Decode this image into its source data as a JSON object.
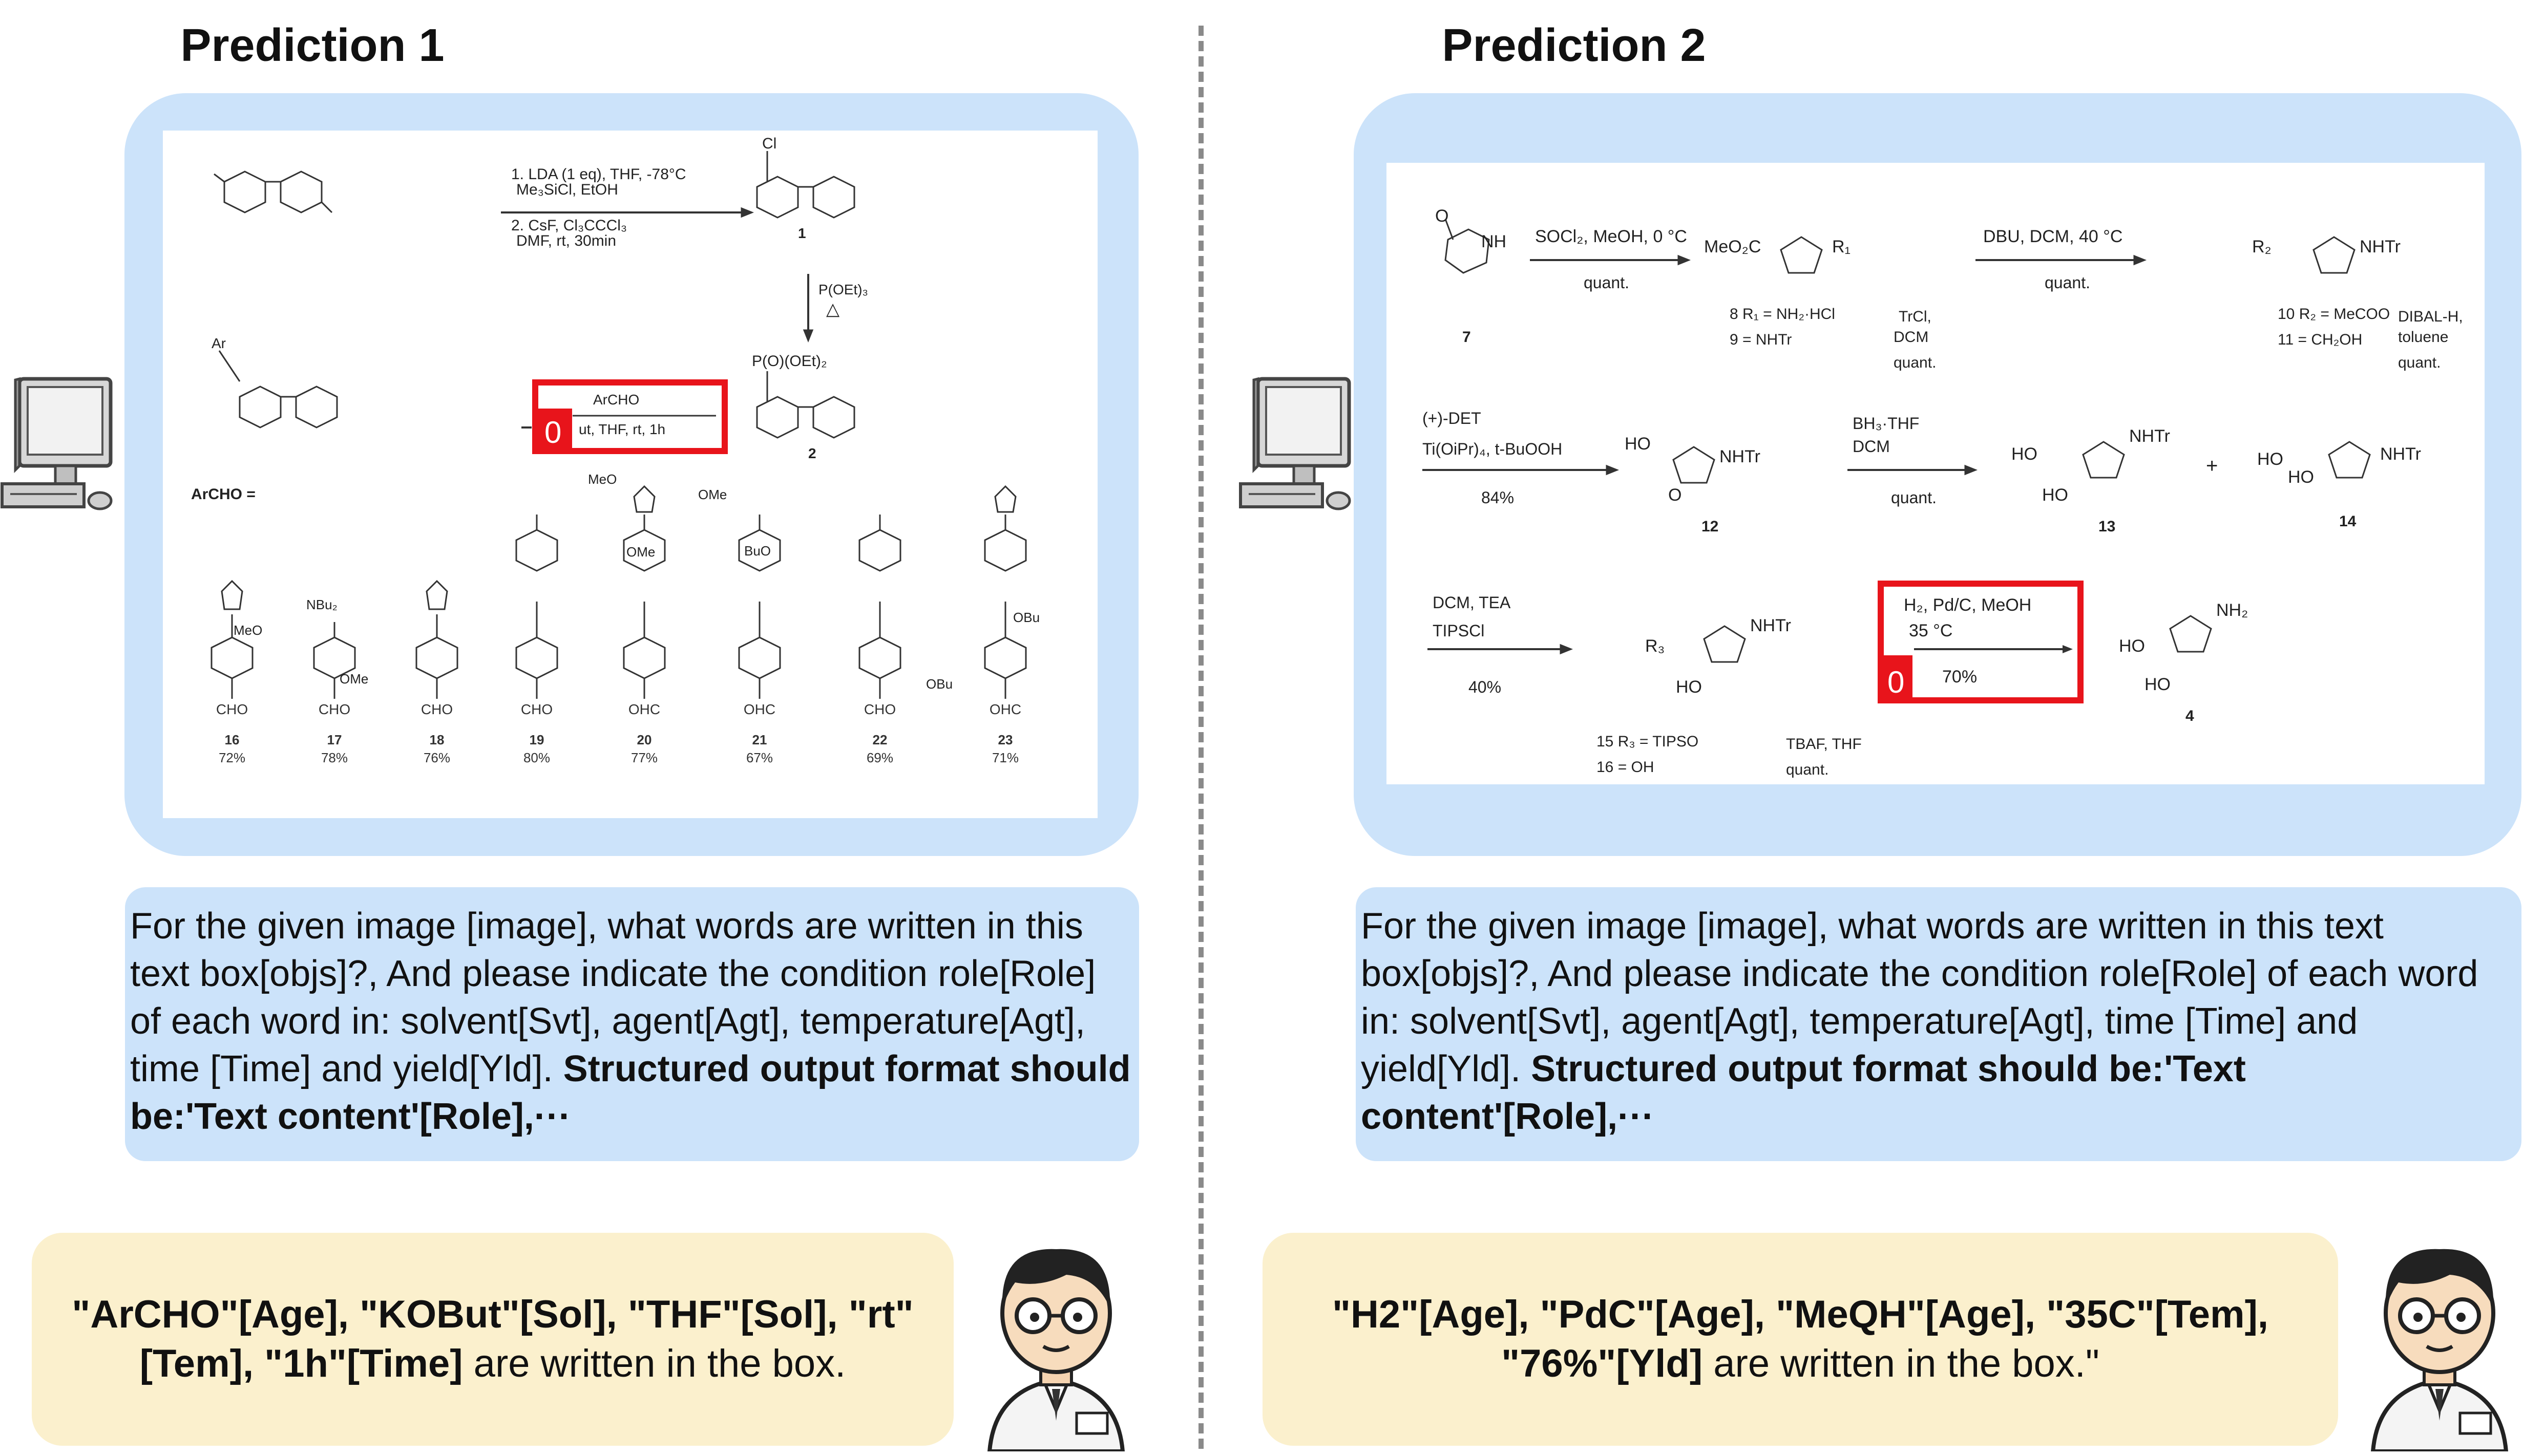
{
  "left": {
    "title": "Prediction 1",
    "question_plain": "For the given image [image], what words are written in this text box[objs]?, And please indicate the condition role[Role] of each word in: solvent[Svt], agent[Agt], temperature[Agt], time [Time] and yield[Yld].",
    "question_bold": "Structured output format should be:'Text content'[Role],···",
    "answer_bold": "\"ArCHO\"[Age], \"KOBut\"[Sol], \"THF\"[Sol], \"rt\" [Tem],  \"1h\"[Time]",
    "answer_plain": " are written in the box.",
    "scheme": {
      "cond_top_1": "1. LDA (1 eq), THF, -78°C",
      "cond_top_2": "Me₃SiCl, EtOH",
      "cond_top_3": "2. CsF, Cl₃CCCl₃",
      "cond_top_4": "DMF, rt, 30min",
      "cond_down": "P(OEt)₃",
      "cond_down_sym": "△",
      "label_1": "1",
      "label_2": "2",
      "phosphonate": "P(O)(OEt)₂",
      "cl": "Cl",
      "ar": "Ar",
      "box_line1": "ArCHO",
      "box_line2": "ut, THF, rt, 1h",
      "box_index": "0",
      "archo_eq": "ArCHO =",
      "compounds": [
        {
          "id": "16",
          "yld": "72%",
          "grp": "CHO"
        },
        {
          "id": "17",
          "yld": "78%",
          "grp": "CHO"
        },
        {
          "id": "18",
          "yld": "76%",
          "grp": "CHO"
        },
        {
          "id": "19",
          "yld": "80%",
          "grp": "CHO"
        },
        {
          "id": "20",
          "yld": "77%",
          "grp": "OHC"
        },
        {
          "id": "21",
          "yld": "67%",
          "grp": "OHC"
        },
        {
          "id": "22",
          "yld": "69%",
          "grp": "CHO"
        },
        {
          "id": "23",
          "yld": "71%",
          "grp": "OHC"
        }
      ],
      "subst": {
        "meo": "MeO",
        "ome": "OMe",
        "nbu2": "NBu₂",
        "buo": "BuO",
        "obu": "OBu",
        "n": "N"
      }
    }
  },
  "right": {
    "title": "Prediction 2",
    "question_plain": "For the given image [image], what words are written in this text box[objs]?, And please indicate the condition role[Role] of each word in: solvent[Svt], agent[Agt], temperature[Agt], time [Time] and yield[Yld].",
    "question_bold": "Structured output format should be:'Text content'[Role],···",
    "answer_bold_1": "\"H2\"[Age], \"PdC\"[Age], \"MeQH\"[Age], \"35C\"[Tem],",
    "answer_bold_2": "\"76%\"[Yld]",
    "answer_plain": " are written in the box.\"",
    "scheme": {
      "c7": "7",
      "nh": "NH",
      "r1_cond": "SOCl₂, MeOH, 0 °C",
      "quant": "quant.",
      "meo2c": "MeO₂C",
      "r1": "R₁",
      "l8": "8  R₁ = NH₂·HCl",
      "l9": "9      = NHTr",
      "trcl": "TrCl,",
      "dcm": "DCM",
      "dbu": "DBU, DCM, 40 °C",
      "r2": "R₂",
      "nhtr": "NHTr",
      "l10": "10  R₂ = MeCOO",
      "l11": "11      = CH₂OH",
      "dibal": "DIBAL-H,",
      "toluene": "toluene",
      "det": "(+)-DET",
      "ti": "Ti(OiPr)₄, t-BuOOH",
      "p84": "84%",
      "ho": "HO",
      "o": "O",
      "c12": "12",
      "bh3": "BH₃·THF",
      "c13": "13",
      "plus": "+",
      "c14": "14",
      "dcm_tea": "DCM, TEA",
      "tipscl": "TIPSCl",
      "p40": "40%",
      "r3": "R₃",
      "box_line1": "H₂, Pd/C, MeOH",
      "box_line2": "35 °C",
      "box_line3": "70%",
      "box_index": "0",
      "nh2": "NH₂",
      "c4": "4",
      "l15": "15  R₃ = TIPSO",
      "l16": "16      = OH",
      "tbaf": "TBAF, THF"
    }
  },
  "colors": {
    "frame_blue": "#cce3fa",
    "answer_yellow": "#fbf0cd",
    "highlight_red": "#e8141b",
    "divider_gray": "#8a8a8a"
  }
}
